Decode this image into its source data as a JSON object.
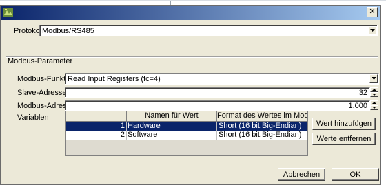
{
  "window": {
    "title": "",
    "close_glyph": "✕"
  },
  "protokoll": {
    "label": "Protokoll",
    "value": "Modbus/RS485"
  },
  "group": {
    "title": "Modbus-Parameter"
  },
  "funktion": {
    "label": "Modbus-Funktion",
    "value": "Read Input Registers (fc=4)"
  },
  "slave": {
    "label": "Slave-Adresse",
    "value": "32"
  },
  "adresse": {
    "label": "Modbus-Adresse",
    "value": "1.000"
  },
  "variablen": {
    "label": "Variablen",
    "columns": [
      "",
      "Namen für Wert",
      "Format des Wertes im Modbus..."
    ],
    "rows": [
      {
        "index": "1",
        "name": "Hardware",
        "format": "Short (16 bit,Big-Endian)",
        "selected": true
      },
      {
        "index": "2",
        "name": "Software",
        "format": "Short (16 bit,Big-Endian)",
        "selected": false
      }
    ],
    "add_button": "Wert hinzufügen",
    "remove_button": "Werte entfernen"
  },
  "footer": {
    "cancel": "Abbrechen",
    "ok": "OK"
  }
}
